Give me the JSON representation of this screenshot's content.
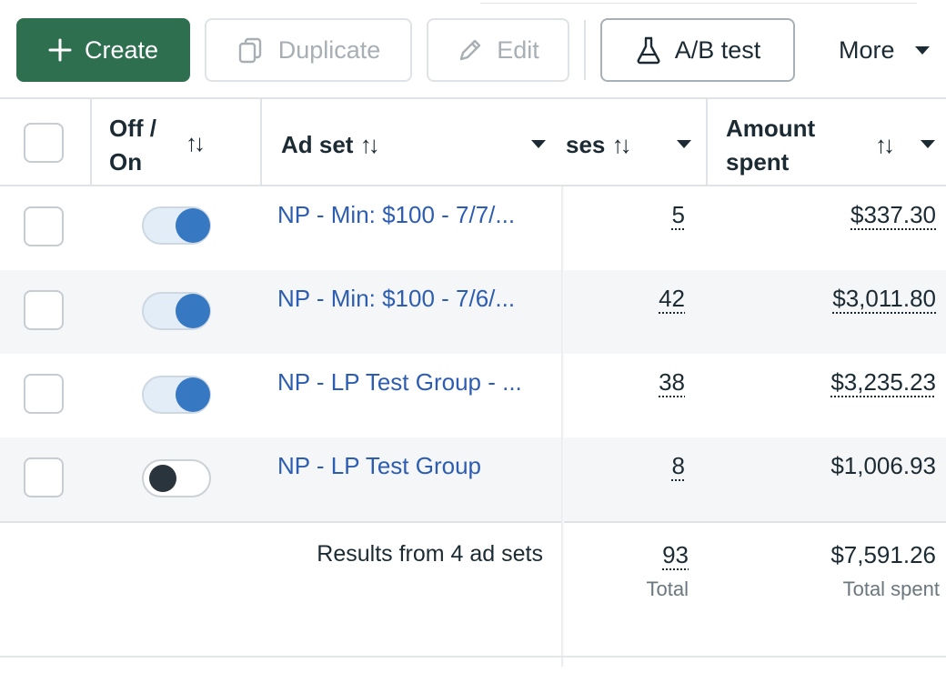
{
  "toolbar": {
    "create_label": "Create",
    "duplicate_label": "Duplicate",
    "edit_label": "Edit",
    "ab_test_label": "A/B test",
    "more_label": "More"
  },
  "columns": {
    "off_on_line1": "Off /",
    "off_on_line2": "On",
    "ad_set": "Ad set",
    "purchases_partial": "ses",
    "amount_line1": "Amount",
    "amount_line2": "spent",
    "sort_glyph": "↑↓"
  },
  "rows": [
    {
      "name": "NP - Min: $100 - 7/7/...",
      "on": true,
      "results": "5",
      "amount": "$337.30",
      "amount_underlined": true
    },
    {
      "name": "NP - Min: $100 - 7/6/...",
      "on": true,
      "results": "42",
      "amount": "$3,011.80",
      "amount_underlined": true
    },
    {
      "name": "NP - LP Test Group - ...",
      "on": true,
      "results": "38",
      "amount": "$3,235.23",
      "amount_underlined": true
    },
    {
      "name": "NP - LP Test Group",
      "on": false,
      "results": "8",
      "amount": "$1,006.93",
      "amount_underlined": false
    }
  ],
  "summary": {
    "label": "Results from 4 ad sets",
    "results_total": "93",
    "results_sub": "Total",
    "amount_total": "$7,591.26",
    "amount_sub": "Total spent"
  },
  "colors": {
    "create_bg": "#2e6f4f",
    "link": "#2d5db3",
    "toggle_on": "#3678c2"
  }
}
